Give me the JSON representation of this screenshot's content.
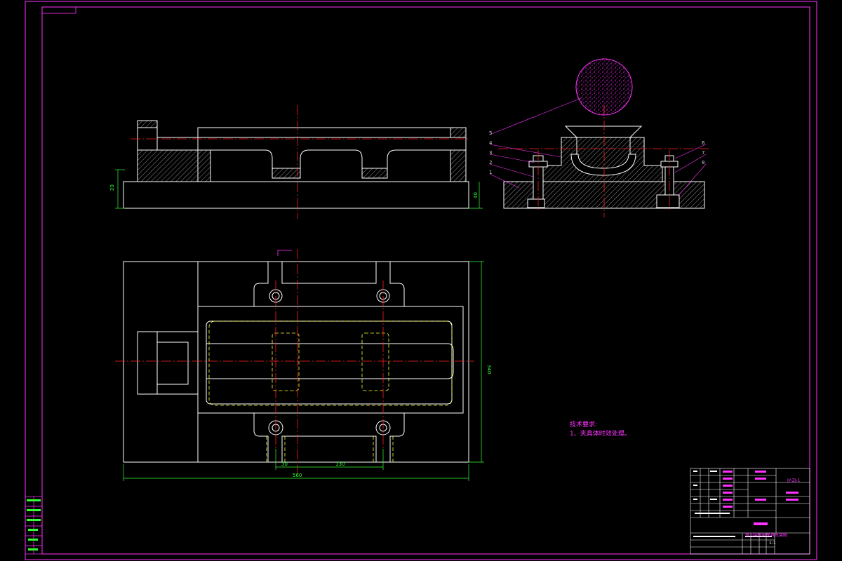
{
  "dimensions": {
    "left_height": "20",
    "right_height": "40",
    "width_total": "560",
    "height_total": "340",
    "spacing_left": "30",
    "spacing_mid": "130"
  },
  "leaders": {
    "left": [
      "5",
      "4",
      "3",
      "2",
      "1"
    ],
    "right": [
      "6",
      "7",
      "8"
    ]
  },
  "notes": {
    "heading": "技术要求:",
    "item1": "1、夹具体时效处理。"
  },
  "title_block": {
    "drawing_title": "铣刀架铣削夹具总装图",
    "ref_code": "JY-ZJ-1",
    "scale": "1:1"
  },
  "colors": {
    "frame": "#ff33ff",
    "outline": "#ffffff",
    "centerline": "#ff2020",
    "hidden": "#ffff33",
    "hatch": "#ffffff",
    "dim": "#33ff33",
    "leader": "#ff33ff"
  }
}
